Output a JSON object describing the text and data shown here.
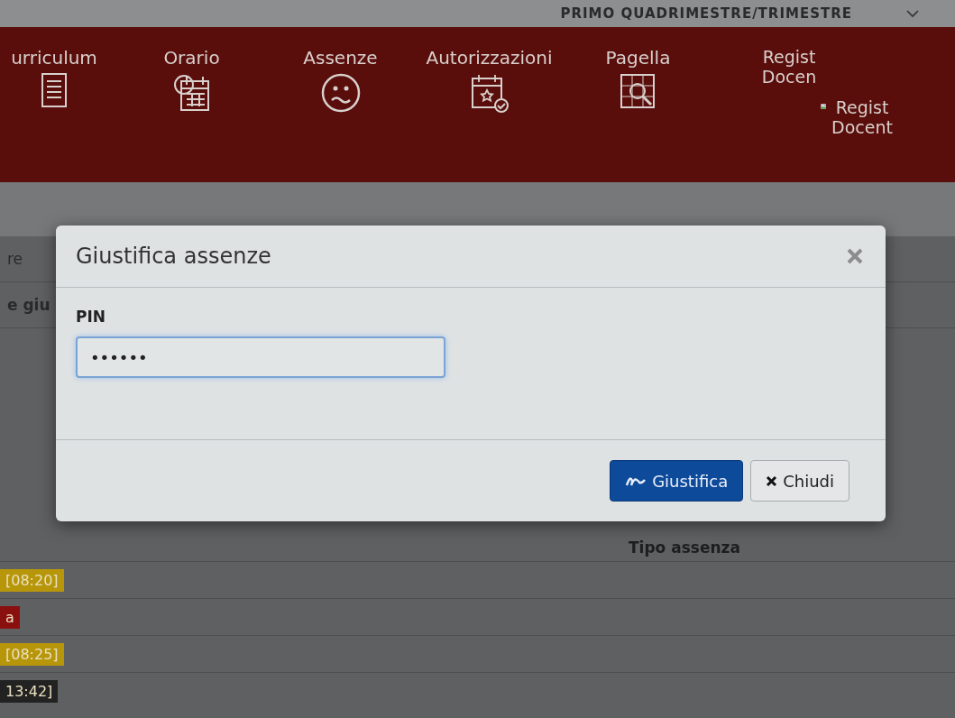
{
  "period_selector": {
    "value": "PRIMO QUADRIMESTRE/TRIMESTRE"
  },
  "nav": [
    {
      "label": "urriculum",
      "kind": "icon"
    },
    {
      "label": "Orario",
      "kind": "icon"
    },
    {
      "label": "Assenze",
      "kind": "icon"
    },
    {
      "label": "Autorizzazioni",
      "kind": "icon"
    },
    {
      "label": "Pagella",
      "kind": "icon"
    },
    {
      "label": "Regist Docen",
      "kind": "plain"
    },
    {
      "label": "Regist Docent",
      "kind": "image"
    }
  ],
  "background": {
    "rows": [
      {
        "text": "re",
        "bold": false
      },
      {
        "text": "e giu",
        "bold": true
      }
    ],
    "column_header": "Tipo assenza",
    "badges": [
      {
        "text": "[08:20]",
        "color": "#b8960a"
      },
      {
        "text": "a",
        "color": "#8a1010"
      },
      {
        "text": "[08:25]",
        "color": "#b8960a"
      },
      {
        "text": "13:42]",
        "color": "#222222"
      }
    ]
  },
  "dialog": {
    "title": "Giustifica assenze",
    "field_label": "PIN",
    "pin_value": "••••••",
    "buttons": [
      {
        "label": "Giustifica",
        "kind": "primary"
      },
      {
        "label": "Chiudi",
        "kind": "default"
      }
    ]
  }
}
